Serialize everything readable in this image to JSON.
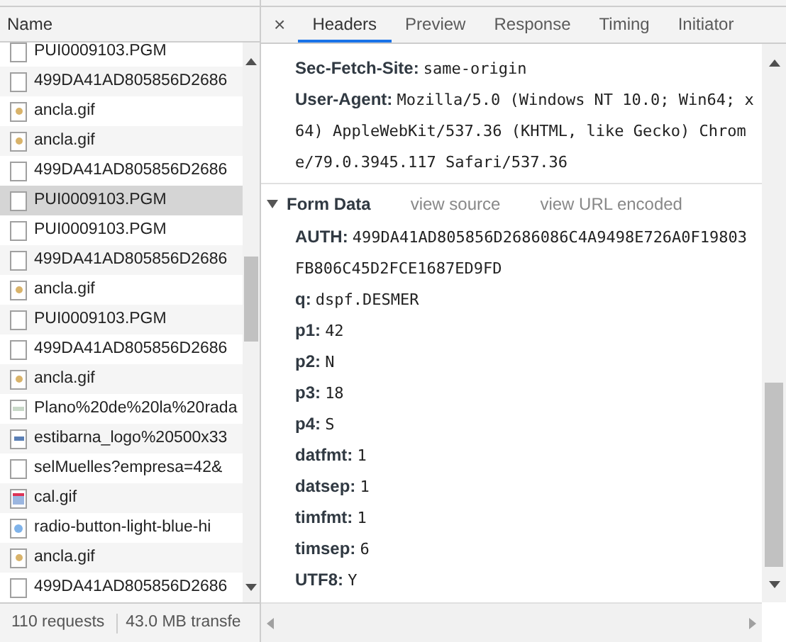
{
  "requests": {
    "column": "Name",
    "rows": [
      {
        "name": "PUI0009103.PGM",
        "kind": "document",
        "selected": false
      },
      {
        "name": "499DA41AD805856D2686",
        "kind": "document",
        "selected": false
      },
      {
        "name": "ancla.gif",
        "kind": "gif",
        "selected": false
      },
      {
        "name": "ancla.gif",
        "kind": "gif",
        "selected": false
      },
      {
        "name": "499DA41AD805856D2686",
        "kind": "document",
        "selected": false
      },
      {
        "name": "PUI0009103.PGM",
        "kind": "document",
        "selected": true
      },
      {
        "name": "PUI0009103.PGM",
        "kind": "document",
        "selected": false
      },
      {
        "name": "499DA41AD805856D2686",
        "kind": "document",
        "selected": false
      },
      {
        "name": "ancla.gif",
        "kind": "gif",
        "selected": false
      },
      {
        "name": "PUI0009103.PGM",
        "kind": "document",
        "selected": false
      },
      {
        "name": "499DA41AD805856D2686",
        "kind": "document",
        "selected": false
      },
      {
        "name": "ancla.gif",
        "kind": "gif",
        "selected": false
      },
      {
        "name": "Plano%20de%20la%20rada",
        "kind": "image",
        "selected": false
      },
      {
        "name": "estibarna_logo%20500x33",
        "kind": "logo",
        "selected": false
      },
      {
        "name": "selMuelles?empresa=42&",
        "kind": "document",
        "selected": false
      },
      {
        "name": "cal.gif",
        "kind": "calendar",
        "selected": false
      },
      {
        "name": "radio-button-light-blue-hi",
        "kind": "radio",
        "selected": false
      },
      {
        "name": "ancla.gif",
        "kind": "gif",
        "selected": false
      },
      {
        "name": "499DA41AD805856D2686",
        "kind": "document",
        "selected": false
      }
    ],
    "status": [
      "110 requests",
      "43.0 MB transfe"
    ]
  },
  "details": {
    "close": "×",
    "tabs": [
      {
        "label": "Headers",
        "selected": true
      },
      {
        "label": "Preview",
        "selected": false
      },
      {
        "label": "Response",
        "selected": false
      },
      {
        "label": "Timing",
        "selected": false
      },
      {
        "label": "Initiator",
        "selected": false
      }
    ],
    "headers": [
      {
        "key": "Sec-Fetch-Site:",
        "value": "same-origin"
      },
      {
        "key": "User-Agent:",
        "value": "Mozilla/5.0 (Windows NT 10.0; Win64; x64) AppleWebKit/537.36 (KHTML, like Gecko) Chrome/79.0.3945.117 Safari/537.36"
      }
    ],
    "form_data": {
      "title": "Form Data",
      "expanded": true,
      "links": [
        "view source",
        "view URL encoded"
      ],
      "fields": [
        {
          "key": "AUTH:",
          "value": "499DA41AD805856D2686086C4A9498E726A0F19803FB806C45D2FCE1687ED9FD"
        },
        {
          "key": "q:",
          "value": "dspf.DESMER"
        },
        {
          "key": "p1:",
          "value": "42"
        },
        {
          "key": "p2:",
          "value": "N"
        },
        {
          "key": "p3:",
          "value": "18"
        },
        {
          "key": "p4:",
          "value": "S"
        },
        {
          "key": "datfmt:",
          "value": "1"
        },
        {
          "key": "datsep:",
          "value": "1"
        },
        {
          "key": "timfmt:",
          "value": "1"
        },
        {
          "key": "timsep:",
          "value": "6"
        },
        {
          "key": "UTF8:",
          "value": "Y"
        }
      ]
    }
  }
}
